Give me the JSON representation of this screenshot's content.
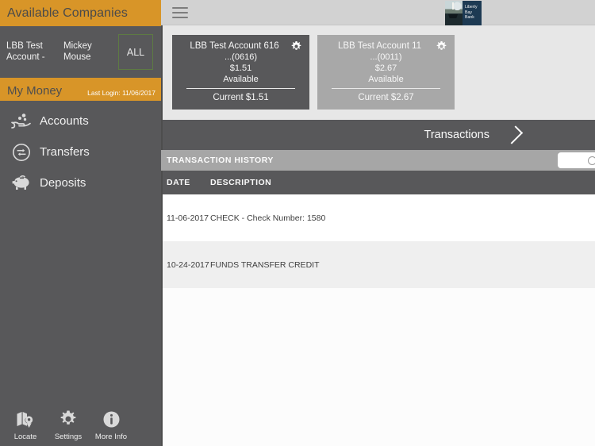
{
  "sidebar": {
    "header_title": "Available Companies",
    "companies": [
      {
        "label": "LBB Test Account -"
      },
      {
        "label": "Mickey Mouse"
      }
    ],
    "all_button_label": "ALL",
    "my_money_title": "My Money",
    "last_login": "Last Login: 11/06/2017",
    "nav_items": [
      {
        "label": "Accounts",
        "icon": "hand-coins-icon"
      },
      {
        "label": "Transfers",
        "icon": "transfer-arrows-icon"
      },
      {
        "label": "Deposits",
        "icon": "piggy-bank-icon"
      }
    ],
    "bottom_items": [
      {
        "label": "Locate",
        "icon": "map-pin-icon"
      },
      {
        "label": "Settings",
        "icon": "gear-icon"
      },
      {
        "label": "More Info",
        "icon": "info-circle-icon"
      }
    ]
  },
  "topbar": {
    "menu_icon": "hamburger-menu-icon",
    "logo_line1": "Liberty",
    "logo_line2": "Bay",
    "logo_line3": "Bank"
  },
  "accounts": [
    {
      "name": "LBB Test Account 616",
      "mask": "...(0616)",
      "available_amount": "$1.51",
      "available_label": "Available",
      "current": "Current $1.51",
      "gear_icon": "gear-icon",
      "selected": true
    },
    {
      "name": "LBB Test Account 11",
      "mask": "...(0011)",
      "available_amount": "$2.67",
      "available_label": "Available",
      "current": "Current $2.67",
      "gear_icon": "gear-icon",
      "selected": false
    }
  ],
  "transactions_band": {
    "label": "Transactions",
    "chevron_icon": "chevron-right-icon"
  },
  "history": {
    "title": "TRANSACTION HISTORY",
    "search_placeholder": "",
    "search_value": "",
    "search_icon": "search-icon",
    "columns": [
      {
        "key": "date",
        "label": "DATE"
      },
      {
        "key": "description",
        "label": "DESCRIPTION"
      }
    ],
    "rows": [
      {
        "date": "11-06-2017",
        "description": "CHECK - Check Number: 1580"
      },
      {
        "date": "10-24-2017",
        "description": "FUNDS TRANSFER CREDIT"
      }
    ]
  },
  "colors": {
    "brand_orange": "#d89528",
    "sidebar_gray": "#58585a",
    "accent_green": "#5d7a43",
    "band_gray": "#a6a6a6",
    "logo_navy": "#1d3a53"
  }
}
